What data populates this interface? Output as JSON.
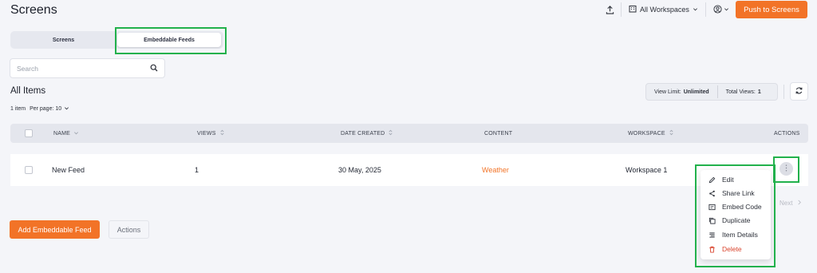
{
  "header": {
    "title": "Screens",
    "workspace_label": "All Workspaces",
    "push_label": "Push to Screens",
    "icons": [
      "upload-icon",
      "building-icon",
      "chevron-down-icon",
      "user-circle-icon"
    ]
  },
  "tabs": [
    {
      "label": "Screens",
      "selected": false
    },
    {
      "label": "Embeddable Feeds",
      "selected": true
    }
  ],
  "search": {
    "placeholder": "Search",
    "value": ""
  },
  "list": {
    "title": "All Items",
    "count_label": "1 item",
    "per_page_label": "Per page: 10",
    "view_limit_label": "View Limit:",
    "view_limit_value": "Unlimited",
    "total_views_label": "Total Views:",
    "total_views_value": "1"
  },
  "table": {
    "columns": [
      "NAME",
      "VIEWS",
      "DATE CREATED",
      "CONTENT",
      "WORKSPACE",
      "ACTIONS"
    ],
    "rows": [
      {
        "name": "New Feed",
        "views": "1",
        "date_created": "30 May, 2025",
        "content": "Weather",
        "workspace": "Workspace 1"
      }
    ]
  },
  "row_menu": {
    "items": [
      {
        "label": "Edit",
        "icon": "pencil-icon"
      },
      {
        "label": "Share Link",
        "icon": "share-icon"
      },
      {
        "label": "Embed Code",
        "icon": "embed-icon"
      },
      {
        "label": "Duplicate",
        "icon": "copy-icon"
      },
      {
        "label": "Item Details",
        "icon": "details-icon"
      },
      {
        "label": "Delete",
        "icon": "trash-icon"
      }
    ]
  },
  "pagination": {
    "next_label": "Next"
  },
  "footer": {
    "add_label": "Add Embeddable Feed",
    "actions_label": "Actions"
  },
  "colors": {
    "accent": "#f27327",
    "highlight": "#22b14c",
    "danger": "#d9432c"
  }
}
